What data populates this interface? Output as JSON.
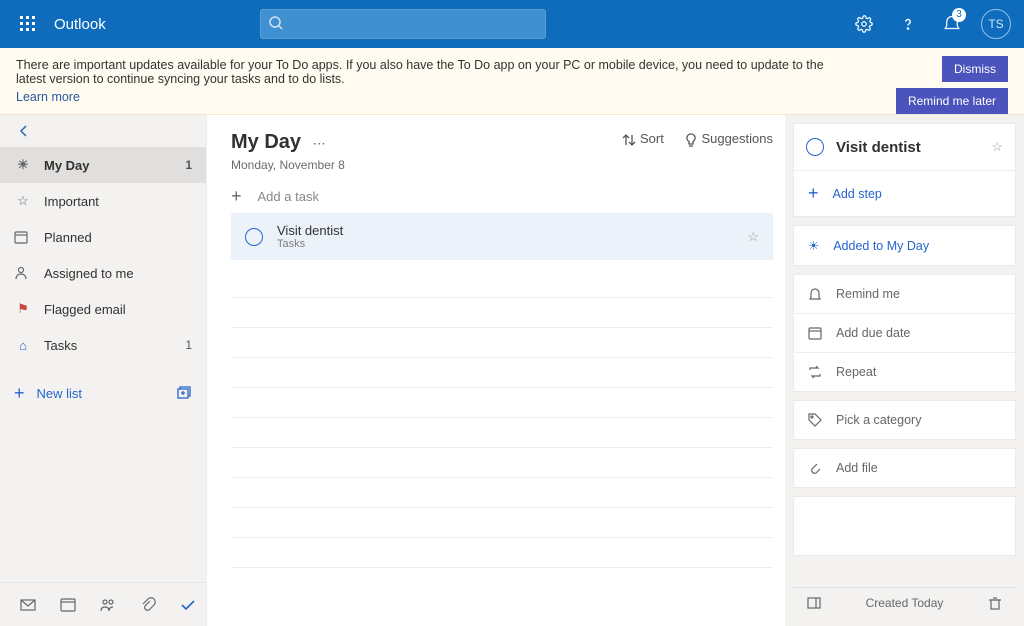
{
  "header": {
    "brand": "Outlook",
    "badge_count": "3",
    "avatar": "TS"
  },
  "notice": {
    "message": "There are important updates available for your To Do apps. If you also have the To Do app on your PC or mobile device, you need to update to the latest version to continue syncing your tasks and to do lists.",
    "learn": "Learn more",
    "dismiss": "Dismiss",
    "remind": "Remind me later"
  },
  "sidebar": {
    "items": [
      {
        "label": "My Day",
        "count": "1"
      },
      {
        "label": "Important",
        "count": ""
      },
      {
        "label": "Planned",
        "count": ""
      },
      {
        "label": "Assigned to me",
        "count": ""
      },
      {
        "label": "Flagged email",
        "count": ""
      },
      {
        "label": "Tasks",
        "count": "1"
      }
    ],
    "newlist": "New list"
  },
  "main": {
    "title": "My Day",
    "subtitle": "Monday, November 8",
    "sort": "Sort",
    "suggestions": "Suggestions",
    "addtask": "Add a task",
    "task": {
      "name": "Visit dentist",
      "sub": "Tasks"
    }
  },
  "detail": {
    "title": "Visit dentist",
    "addstep": "Add step",
    "myday": "Added to My Day",
    "remind": "Remind me",
    "due": "Add due date",
    "repeat": "Repeat",
    "category": "Pick a category",
    "file": "Add file",
    "created": "Created Today"
  }
}
